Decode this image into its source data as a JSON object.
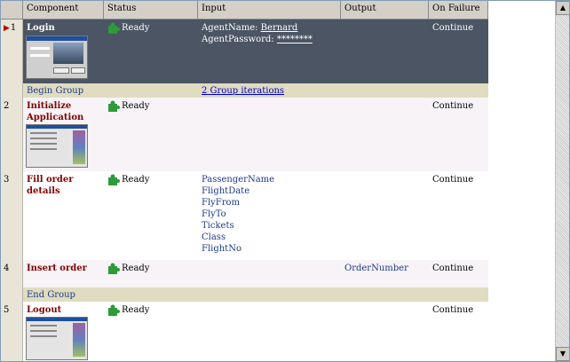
{
  "columns": {
    "component": "Component",
    "status": "Status",
    "input": "Input",
    "output": "Output",
    "on_failure": "On Failure"
  },
  "rows": [
    {
      "num": "1",
      "name": "Login",
      "status": "Ready",
      "input": [
        "AgentName: ",
        "Bernard",
        "AgentPassword: ",
        "********"
      ],
      "output": "",
      "on_failure": "Continue",
      "selected": true
    },
    {
      "num": "2",
      "name": "Initialize Application",
      "status": "Ready",
      "input": [],
      "output": "",
      "on_failure": "Continue"
    },
    {
      "num": "3",
      "name": "Fill order details",
      "status": "Ready",
      "input": [
        "PassengerName",
        "FlightDate",
        "FlyFrom",
        "FlyTo",
        "Tickets",
        "Class",
        "FlightNo"
      ],
      "output": "",
      "on_failure": "Continue"
    },
    {
      "num": "4",
      "name": "Insert order",
      "status": "Ready",
      "input": [],
      "output": "OrderNumber",
      "on_failure": "Continue"
    },
    {
      "num": "5",
      "name": "Logout",
      "status": "Ready",
      "input": [],
      "output": "",
      "on_failure": "Continue"
    }
  ],
  "group": {
    "begin": "Begin Group",
    "iterations_link": "2 Group iterations",
    "end": "End Group"
  },
  "scrollbar": {
    "up_icon": "arrow-up-icon",
    "down_icon": "arrow-down-icon"
  },
  "colors": {
    "selected_row": "#4b5563",
    "group_row": "#e0dcc0",
    "component_name": "#800000",
    "param": "#1a3a8a"
  }
}
